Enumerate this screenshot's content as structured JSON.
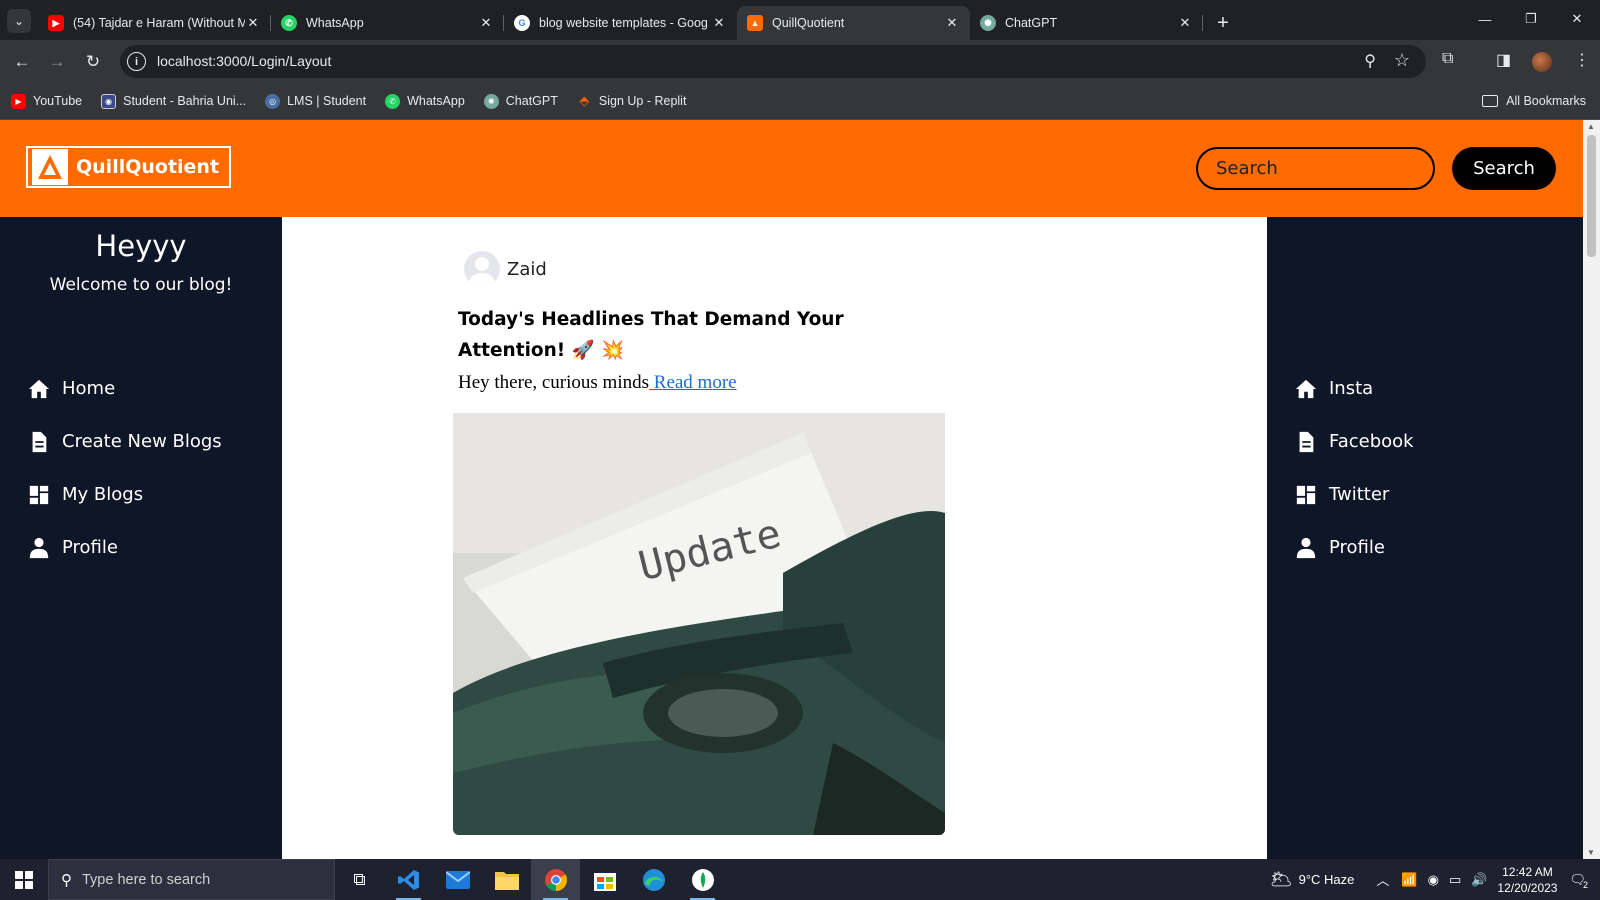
{
  "browser": {
    "tabs": [
      {
        "title": "(54) Tajdar e Haram (Without M",
        "favicon": "youtube-icon",
        "color": "#ff0000",
        "active": false
      },
      {
        "title": "WhatsApp",
        "favicon": "whatsapp-icon",
        "color": "#25d366",
        "active": false
      },
      {
        "title": "blog website templates - Goog",
        "favicon": "google-icon",
        "color": "#ffffff",
        "active": false
      },
      {
        "title": "QuillQuotient",
        "favicon": "quillquotient-icon",
        "color": "#ff6b00",
        "active": true
      },
      {
        "title": "ChatGPT",
        "favicon": "chatgpt-icon",
        "color": "#74aa9c",
        "active": false
      }
    ],
    "address": "localhost:3000/Login/Layout",
    "bookmarks": [
      {
        "label": "YouTube",
        "icon": "youtube-icon",
        "color": "#ff0000"
      },
      {
        "label": "Student - Bahria Uni...",
        "icon": "bahria-icon",
        "color": "#3a4a8a"
      },
      {
        "label": "LMS | Student",
        "icon": "lms-icon",
        "color": "#4a6fa5"
      },
      {
        "label": "WhatsApp",
        "icon": "whatsapp-icon",
        "color": "#25d366"
      },
      {
        "label": "ChatGPT",
        "icon": "chatgpt-icon",
        "color": "#74aa9c"
      },
      {
        "label": "Sign Up - Replit",
        "icon": "replit-icon",
        "color": "#f26207"
      }
    ],
    "all_bookmarks": "All Bookmarks"
  },
  "site": {
    "logo_text": "QuillQuotient",
    "search_placeholder": "Search",
    "search_button": "Search",
    "accent": "#ff6b00",
    "sidebar_bg": "#0e1628"
  },
  "sidebar_left": {
    "greeting": "Heyyy",
    "welcome": "Welcome to our blog!",
    "items": [
      {
        "label": "Home",
        "icon": "home-icon"
      },
      {
        "label": "Create New Blogs",
        "icon": "document-icon"
      },
      {
        "label": "My Blogs",
        "icon": "dashboard-icon"
      },
      {
        "label": "Profile",
        "icon": "user-icon"
      }
    ]
  },
  "sidebar_right": {
    "items": [
      {
        "label": "Insta",
        "icon": "home-icon"
      },
      {
        "label": "Facebook",
        "icon": "document-icon"
      },
      {
        "label": "Twitter",
        "icon": "dashboard-icon"
      },
      {
        "label": "Profile",
        "icon": "user-icon"
      }
    ]
  },
  "post": {
    "author": "Zaid",
    "title": "Today's Headlines That Demand Your Attention! 🚀 💥",
    "excerpt": "Hey there, curious minds",
    "read_more": " Read more",
    "image_text": "Update"
  },
  "taskbar": {
    "search_placeholder": "Type here to search",
    "weather": "9°C  Haze",
    "time": "12:42 AM",
    "date": "12/20/2023",
    "notifications": "2"
  }
}
